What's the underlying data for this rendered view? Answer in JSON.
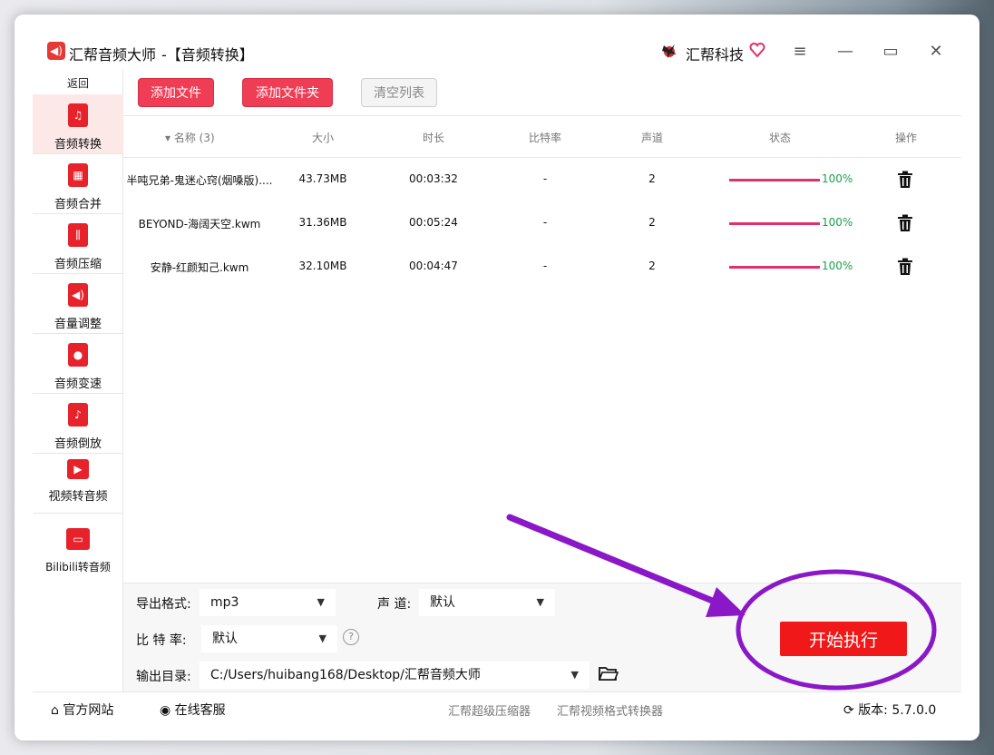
{
  "window": {
    "app_title": "汇帮音频大师",
    "subtitle": "-【音频转换】",
    "brand": "汇帮科技",
    "controls": {
      "menu": "≡",
      "minimize": "—",
      "maximize": "▭",
      "close": "✕"
    }
  },
  "sidebar": {
    "back": "返回",
    "items": [
      {
        "label": "音频转换",
        "icon": "audio-convert-icon",
        "active": true
      },
      {
        "label": "音频合并",
        "icon": "audio-merge-icon"
      },
      {
        "label": "音频压缩",
        "icon": "audio-compress-icon"
      },
      {
        "label": "音量调整",
        "icon": "volume-icon"
      },
      {
        "label": "音频变速",
        "icon": "microphone-icon"
      },
      {
        "label": "音频倒放",
        "icon": "music-note-icon"
      },
      {
        "label": "视频转音频",
        "icon": "film-icon"
      },
      {
        "label": "Bilibili转音频",
        "icon": "tv-icon"
      }
    ]
  },
  "toolbar": {
    "add_file": "添加文件",
    "add_folder": "添加文件夹",
    "clear_list": "清空列表"
  },
  "table": {
    "columns": [
      "名称 (3)",
      "大小",
      "时长",
      "比特率",
      "声道",
      "状态",
      "操作"
    ],
    "rows": [
      {
        "name": "半吨兄弟-鬼迷心窍(烟嗓版)....",
        "size": "43.73MB",
        "duration": "00:03:32",
        "bitrate": "-",
        "channels": "2",
        "progress": 100,
        "status": "100%"
      },
      {
        "name": "BEYOND-海阔天空.kwm",
        "size": "31.36MB",
        "duration": "00:05:24",
        "bitrate": "-",
        "channels": "2",
        "progress": 100,
        "status": "100%"
      },
      {
        "name": "安静-红颜知己.kwm",
        "size": "32.10MB",
        "duration": "00:04:47",
        "bitrate": "-",
        "channels": "2",
        "progress": 100,
        "status": "100%"
      }
    ]
  },
  "settings": {
    "format_label": "导出格式:",
    "format_value": "mp3",
    "channel_label": "声 道:",
    "channel_value": "默认",
    "bitrate_label": "比 特 率:",
    "bitrate_value": "默认",
    "help": "?",
    "output_label": "输出目录:",
    "output_value": "C:/Users/huibang168/Desktop/汇帮音频大师",
    "start": "开始执行"
  },
  "footer": {
    "website": "官方网站",
    "support": "在线客服",
    "link1": "汇帮超级压缩器",
    "link2": "汇帮视频格式转换器",
    "version_label": "版本:",
    "version": "5.7.0.0"
  },
  "colors": {
    "accent_red": "#ee3d55",
    "start_red": "#f01818",
    "progress": "#e0306e",
    "status_green": "#1aa24b",
    "annotation_purple": "#8a18c8"
  }
}
